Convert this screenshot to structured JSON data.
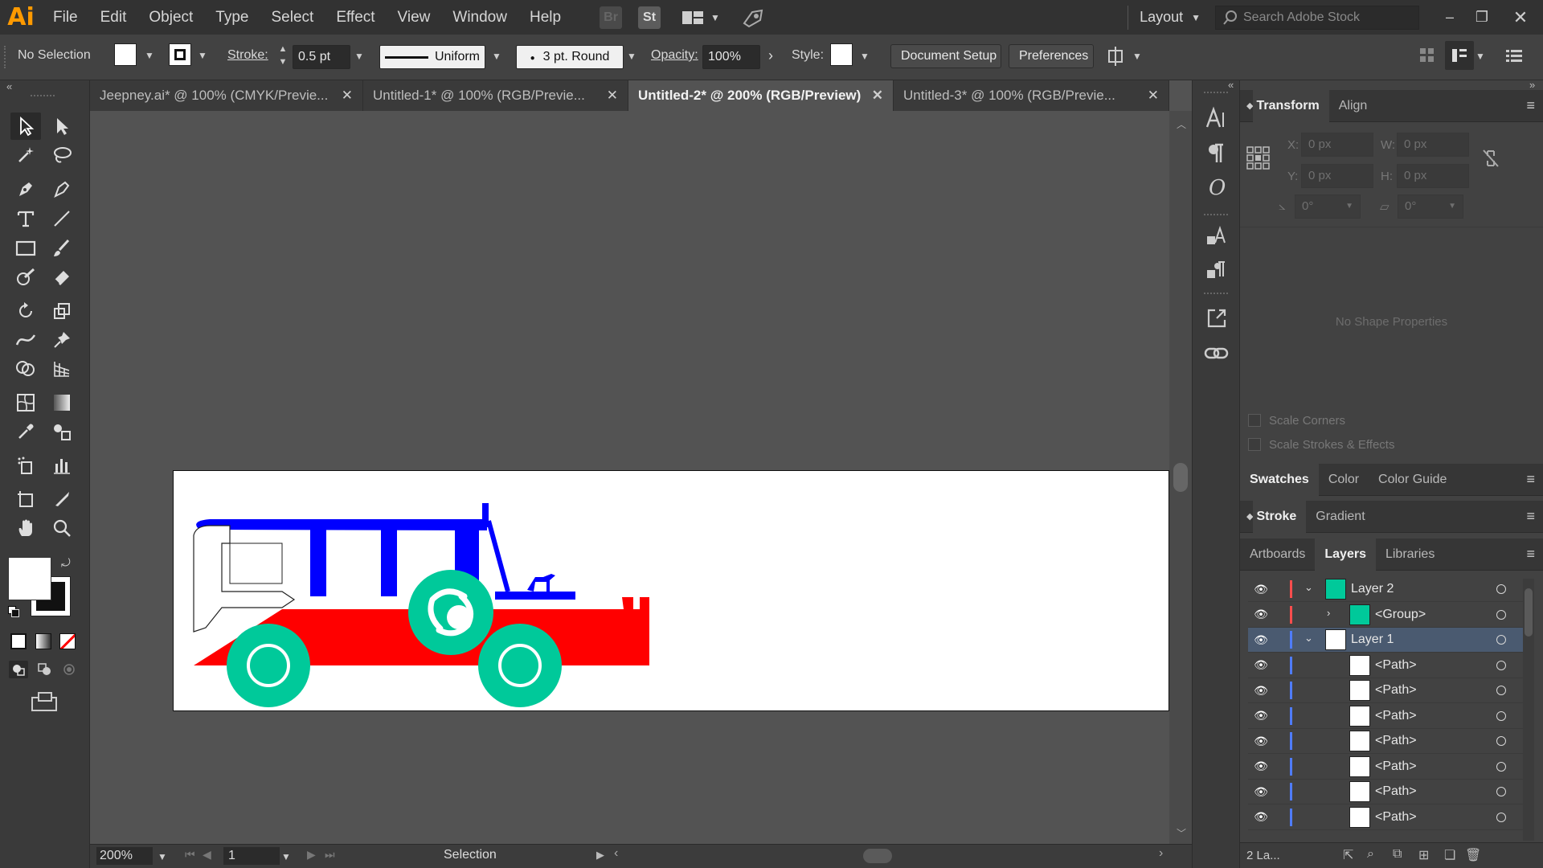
{
  "app": {
    "logo": "Ai"
  },
  "menu": [
    "File",
    "Edit",
    "Object",
    "Type",
    "Select",
    "Effect",
    "View",
    "Window",
    "Help"
  ],
  "menubar_right": {
    "bridge": "Br",
    "stock": "St",
    "workspace": "Layout",
    "search_placeholder": "Search Adobe Stock"
  },
  "control": {
    "selection": "No Selection",
    "stroke_label": "Stroke:",
    "stroke_value": "0.5 pt",
    "profile": "Uniform",
    "brush": "3 pt. Round",
    "opacity_label": "Opacity:",
    "opacity_value": "100%",
    "style_label": "Style:",
    "document_setup": "Document Setup",
    "preferences": "Preferences"
  },
  "tabs": [
    {
      "label": "Jeepney.ai* @ 100% (CMYK/Previe...",
      "active": false
    },
    {
      "label": "Untitled-1* @ 100% (RGB/Previe...",
      "active": false
    },
    {
      "label": "Untitled-2* @ 200% (RGB/Preview)",
      "active": true
    },
    {
      "label": "Untitled-3* @ 100% (RGB/Previe...",
      "active": false
    }
  ],
  "status": {
    "zoom": "200%",
    "artboard": "1",
    "tool": "Selection"
  },
  "transform": {
    "tabs": [
      "Transform",
      "Align"
    ],
    "x": "0 px",
    "y": "0 px",
    "w": "0 px",
    "h": "0 px",
    "x_label": "X:",
    "y_label": "Y:",
    "w_label": "W:",
    "h_label": "H:",
    "angle": "0°",
    "shear": "0°",
    "no_props": "No Shape Properties",
    "scale_corners": "Scale Corners",
    "scale_strokes": "Scale Strokes & Effects"
  },
  "panel_tabs": {
    "swatches": [
      "Swatches",
      "Color",
      "Color Guide"
    ],
    "stroke": [
      "Stroke",
      "Gradient"
    ],
    "layers": [
      "Artboards",
      "Layers",
      "Libraries"
    ]
  },
  "layers": [
    {
      "name": "Layer 2",
      "indent": 0,
      "expanded": true,
      "color": "#ff4d4d",
      "selected": false
    },
    {
      "name": "<Group>",
      "indent": 1,
      "expanded": false,
      "color": "#ff4d4d",
      "selected": false
    },
    {
      "name": "Layer 1",
      "indent": 0,
      "expanded": true,
      "color": "#4f7cff",
      "selected": true
    },
    {
      "name": "<Path>",
      "indent": 2,
      "color": "#4f7cff",
      "selected": false
    },
    {
      "name": "<Path>",
      "indent": 2,
      "color": "#4f7cff",
      "selected": false
    },
    {
      "name": "<Path>",
      "indent": 2,
      "color": "#4f7cff",
      "selected": false
    },
    {
      "name": "<Path>",
      "indent": 2,
      "color": "#4f7cff",
      "selected": false
    },
    {
      "name": "<Path>",
      "indent": 2,
      "color": "#4f7cff",
      "selected": false
    },
    {
      "name": "<Path>",
      "indent": 2,
      "color": "#4f7cff",
      "selected": false
    },
    {
      "name": "<Path>",
      "indent": 2,
      "color": "#4f7cff",
      "selected": false
    }
  ],
  "layers_footer": "2 La...",
  "colors": {
    "teal": "#00c99a",
    "blue": "#0000ff",
    "red": "#ff0000"
  }
}
